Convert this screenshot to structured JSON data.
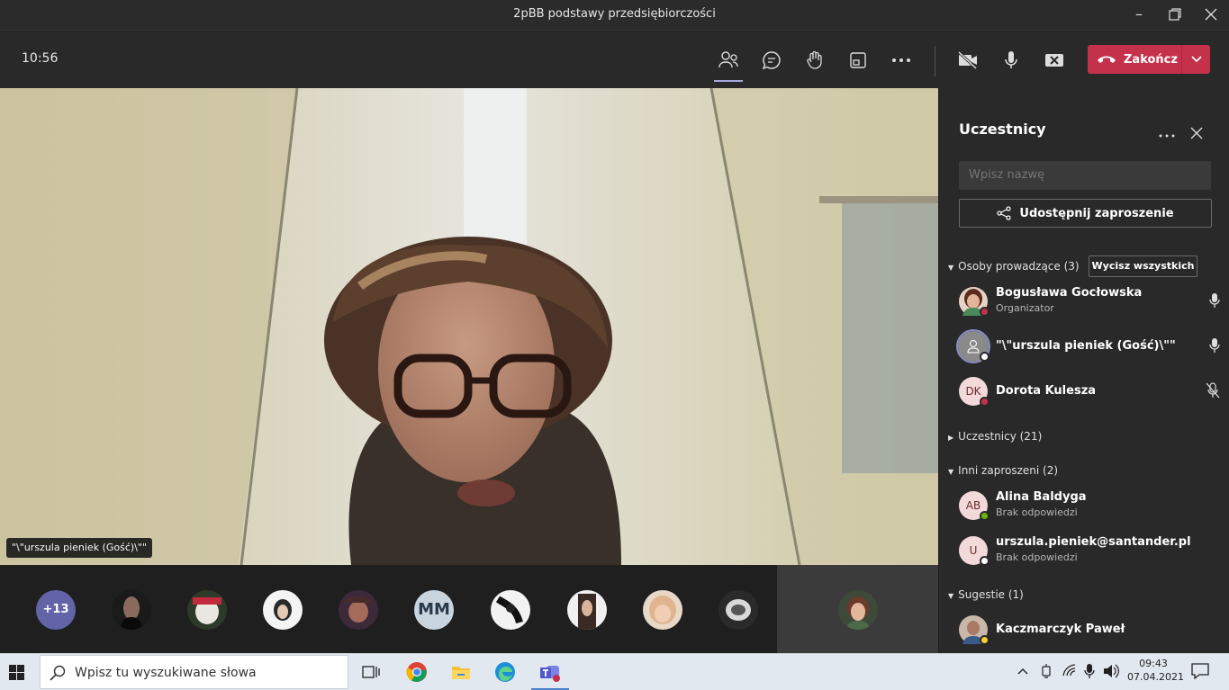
{
  "window": {
    "title": "2pBB podstawy przedsiębiorczości"
  },
  "toolbar": {
    "clock": "10:56",
    "end_label": "Zakończ",
    "accent": "#c4314b"
  },
  "stage": {
    "speaker_label": "\"\\\"urszula pieniek (Gość)\\\"\""
  },
  "strip": {
    "overflow_count": "+13",
    "initials_tile": "MM"
  },
  "panel": {
    "title": "Uczestnicy",
    "search_placeholder": "Wpisz nazwę",
    "invite_label": "Udostępnij zaproszenie",
    "presenters_header": "Osoby prowadzące (3)",
    "mute_all_label": "Wycisz wszystkich",
    "presenters": [
      {
        "name": "Bogusława Gocłowska",
        "role": "Organizator"
      },
      {
        "name": "\"\\\"urszula pieniek (Gość)\\\"\""
      },
      {
        "name": "Dorota Kulesza",
        "initials": "DK"
      }
    ],
    "attendees_header": "Uczestnicy (21)",
    "invited_header": "Inni zaproszeni (2)",
    "invited": [
      {
        "name": "Alina Baldyga",
        "initials": "AB",
        "status": "Brak odpowiedzi"
      },
      {
        "name": "urszula.pieniek@santander.pl",
        "initials": "U",
        "status": "Brak odpowiedzi"
      }
    ],
    "suggestions_header": "Sugestie (1)",
    "suggestions": [
      {
        "name": "Kaczmarczyk Paweł"
      }
    ]
  },
  "taskbar": {
    "search_placeholder": "Wpisz tu wyszukiwane słowa",
    "time": "09:43",
    "date": "07.04.2021"
  }
}
